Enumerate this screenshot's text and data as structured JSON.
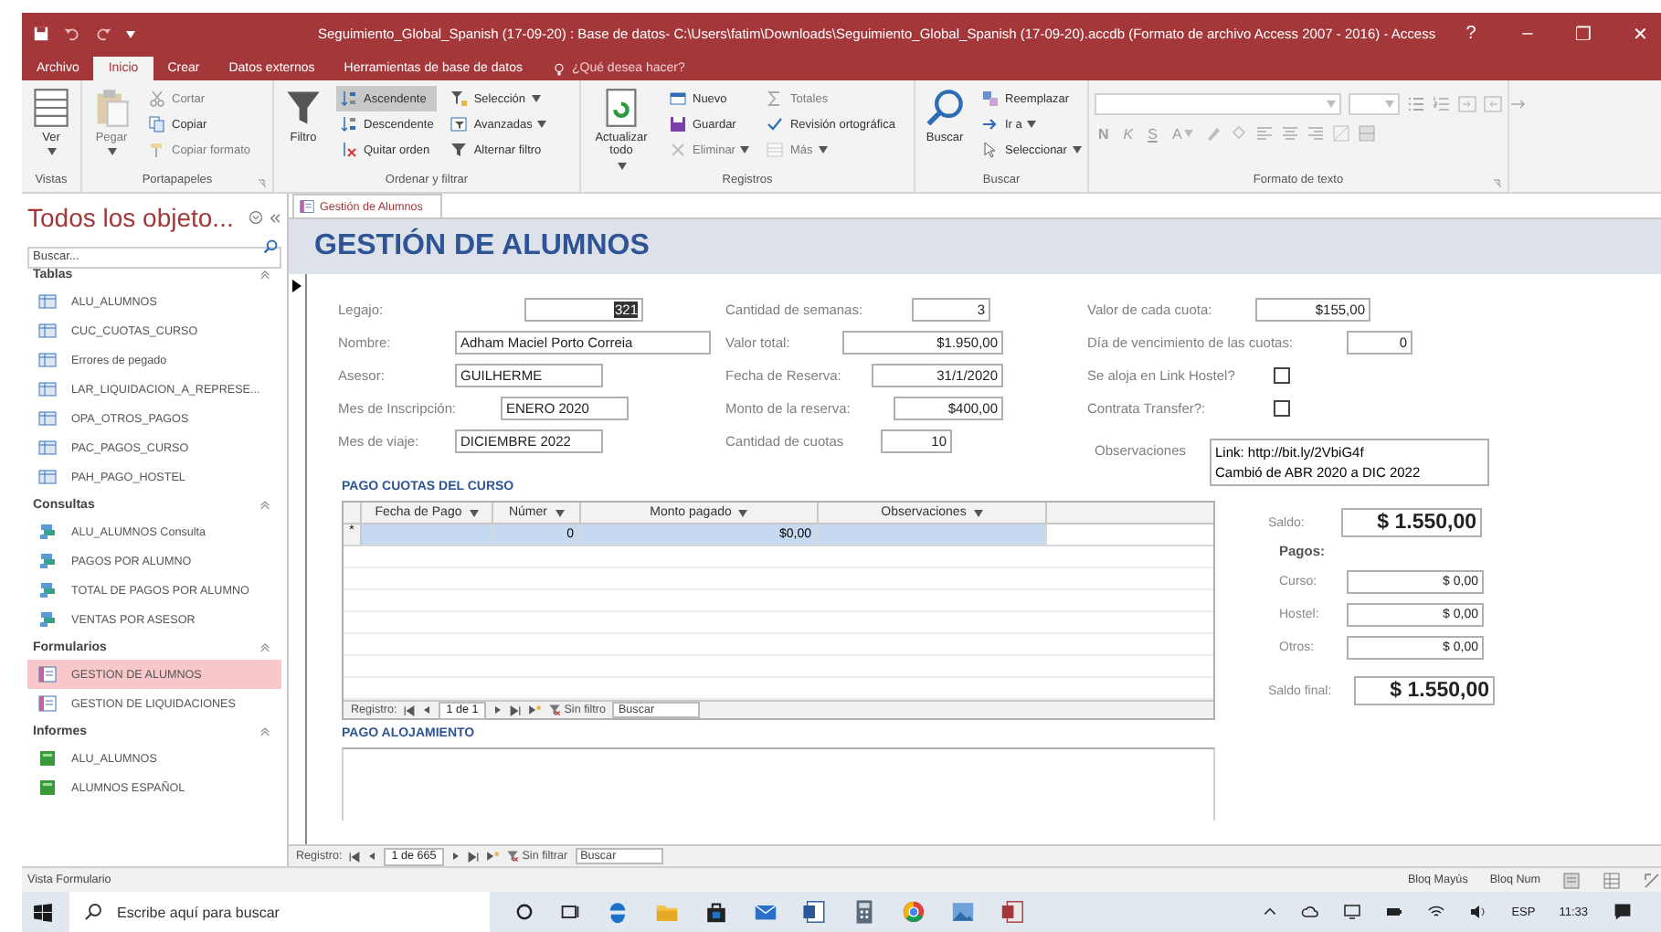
{
  "window": {
    "title": "Seguimiento_Global_Spanish (17-09-20) : Base de datos- C:\\Users\\fatim\\Downloads\\Seguimiento_Global_Spanish (17-09-20).accdb (Formato de archivo Access 2007 - 2016) - Access",
    "controls": [
      "?",
      "–",
      "❐",
      "✕"
    ]
  },
  "ribbon_tabs": [
    {
      "label": "Archivo",
      "selected": false
    },
    {
      "label": "Inicio",
      "selected": true
    },
    {
      "label": "Crear",
      "selected": false
    },
    {
      "label": "Datos externos",
      "selected": false
    },
    {
      "label": "Herramientas de base de datos",
      "selected": false
    }
  ],
  "tell_me": {
    "placeholder": "¿Qué desea hacer?"
  },
  "ribbon_groups": [
    {
      "label": "Vistas",
      "kind": "buttons",
      "large": [
        {
          "label": "Ver",
          "kind": "view",
          "disabled": false,
          "pressed": false,
          "dropdown": true
        }
      ]
    },
    {
      "label": "Portapapeles",
      "kind": "buttons",
      "launcher": true,
      "large": [
        {
          "label": "Pegar",
          "kind": "paste",
          "disabled": true,
          "pressed": false,
          "dropdown": true
        }
      ],
      "columns": [
        [
          {
            "label": "Cortar",
            "kind": "cut",
            "disabled": true,
            "pressed": false,
            "dropdown": false
          },
          {
            "label": "Copiar",
            "kind": "copy",
            "disabled": false,
            "pressed": false,
            "dropdown": false
          },
          {
            "label": "Copiar formato",
            "kind": "brush",
            "disabled": true,
            "pressed": false,
            "dropdown": false
          }
        ]
      ]
    },
    {
      "label": "Ordenar y filtrar",
      "kind": "buttons",
      "large": [
        {
          "label": "Filtro",
          "kind": "filter",
          "disabled": false,
          "pressed": false,
          "dropdown": false
        }
      ],
      "columns": [
        [
          {
            "label": "Ascendente",
            "kind": "sort-asc",
            "disabled": false,
            "pressed": true,
            "dropdown": false
          },
          {
            "label": "Descendente",
            "kind": "sort-desc",
            "disabled": false,
            "pressed": false,
            "dropdown": false
          },
          {
            "label": "Quitar orden",
            "kind": "clear-sort",
            "disabled": false,
            "pressed": false,
            "dropdown": false
          }
        ],
        [
          {
            "label": "Selección",
            "kind": "selection",
            "disabled": false,
            "pressed": false,
            "dropdown": true
          },
          {
            "label": "Avanzadas",
            "kind": "advanced",
            "disabled": false,
            "pressed": false,
            "dropdown": true
          },
          {
            "label": "Alternar filtro",
            "kind": "toggle-filter",
            "disabled": false,
            "pressed": false,
            "dropdown": false
          }
        ]
      ]
    },
    {
      "label": "Registros",
      "kind": "buttons",
      "large": [
        {
          "label": "Actualizar todo",
          "kind": "refresh",
          "disabled": false,
          "pressed": false,
          "dropdown": true
        }
      ],
      "columns": [
        [
          {
            "label": "Nuevo",
            "kind": "new",
            "disabled": false,
            "pressed": false,
            "dropdown": false
          },
          {
            "label": "Guardar",
            "kind": "save",
            "disabled": false,
            "pressed": false,
            "dropdown": false
          },
          {
            "label": "Eliminar",
            "kind": "delete",
            "disabled": true,
            "pressed": false,
            "dropdown": true
          }
        ],
        [
          {
            "label": "Totales",
            "kind": "totals",
            "disabled": true,
            "pressed": false,
            "dropdown": false
          },
          {
            "label": "Revisión ortográfica",
            "kind": "spell",
            "disabled": false,
            "pressed": false,
            "dropdown": false
          },
          {
            "label": "Más",
            "kind": "more",
            "disabled": true,
            "pressed": false,
            "dropdown": true
          }
        ]
      ]
    },
    {
      "label": "Buscar",
      "kind": "buttons",
      "large": [
        {
          "label": "Buscar",
          "kind": "search",
          "disabled": false,
          "pressed": false,
          "dropdown": false
        }
      ],
      "columns": [
        [
          {
            "label": "Reemplazar",
            "kind": "replace",
            "disabled": false,
            "pressed": false,
            "dropdown": false
          },
          {
            "label": "Ir a",
            "kind": "goto",
            "disabled": false,
            "pressed": false,
            "dropdown": true
          },
          {
            "label": "Seleccionar",
            "kind": "select",
            "disabled": false,
            "pressed": false,
            "dropdown": true
          }
        ]
      ]
    },
    {
      "label": "Formato de texto",
      "kind": "format",
      "launcher": true,
      "glyphs": [
        "N",
        "K",
        "S",
        "A"
      ]
    }
  ],
  "nav_pane": {
    "title": "Todos los objeto...",
    "search": {
      "placeholder": "Buscar..."
    },
    "sections": [
      {
        "label": "Tablas",
        "kind": "table",
        "items": [
          {
            "label": "ALU_ALUMNOS",
            "selected": false
          },
          {
            "label": "CUC_CUOTAS_CURSO",
            "selected": false
          },
          {
            "label": "Errores de pegado",
            "selected": false
          },
          {
            "label": "LAR_LIQUIDACION_A_REPRESE...",
            "selected": false
          },
          {
            "label": "OPA_OTROS_PAGOS",
            "selected": false
          },
          {
            "label": "PAC_PAGOS_CURSO",
            "selected": false
          },
          {
            "label": "PAH_PAGO_HOSTEL",
            "selected": false
          }
        ]
      },
      {
        "label": "Consultas",
        "kind": "query",
        "items": [
          {
            "label": "ALU_ALUMNOS Consulta",
            "selected": false
          },
          {
            "label": "PAGOS POR ALUMNO",
            "selected": false
          },
          {
            "label": "TOTAL DE PAGOS POR ALUMNO",
            "selected": false
          },
          {
            "label": "VENTAS POR ASESOR",
            "selected": false
          }
        ]
      },
      {
        "label": "Formularios",
        "kind": "form",
        "items": [
          {
            "label": "GESTION DE ALUMNOS",
            "selected": true
          },
          {
            "label": "GESTION DE LIQUIDACIONES",
            "selected": false
          }
        ]
      },
      {
        "label": "Informes",
        "kind": "report",
        "items": [
          {
            "label": "ALU_ALUMNOS",
            "selected": false
          },
          {
            "label": "ALUMNOS ESPAÑOL",
            "selected": false
          }
        ]
      }
    ]
  },
  "document_tab": {
    "label": "Gestión de Alumnos"
  },
  "form": {
    "title": "GESTIÓN DE ALUMNOS",
    "columns": [
      [
        {
          "label": "Legajo:",
          "kind": "number",
          "value": "321",
          "selected": true
        },
        {
          "label": "Nombre:",
          "kind": "text",
          "value": "Adham Maciel Porto Correia",
          "selected": false
        },
        {
          "label": "Asesor:",
          "kind": "text",
          "value": "GUILHERME",
          "selected": false
        },
        {
          "label": "Mes de Inscripción:",
          "kind": "text",
          "value": "ENERO 2020",
          "selected": false
        },
        {
          "label": "Mes de viaje:",
          "kind": "text",
          "value": "DICIEMBRE 2022",
          "selected": false
        }
      ],
      [
        {
          "label": "Cantidad de semanas:",
          "kind": "number",
          "value": "3",
          "selected": false
        },
        {
          "label": "Valor total:",
          "kind": "number",
          "value": "$1.950,00",
          "selected": false
        },
        {
          "label": "Fecha de Reserva:",
          "kind": "number",
          "value": "31/1/2020",
          "selected": false
        },
        {
          "label": "Monto de la reserva:",
          "kind": "number",
          "value": "$400,00",
          "selected": false
        },
        {
          "label": "Cantidad de cuotas",
          "kind": "number",
          "value": "10",
          "selected": false
        }
      ],
      [
        {
          "label": "Valor de  cada cuota:",
          "kind": "number",
          "value": "$155,00",
          "selected": false
        },
        {
          "label": "Día de vencimiento de las cuotas:",
          "kind": "number",
          "value": "0",
          "selected": false
        },
        {
          "label": "Se aloja en Link Hostel?",
          "kind": "checkbox",
          "checked": false
        },
        {
          "label": "Contrata Transfer?:",
          "kind": "checkbox",
          "checked": false
        },
        {
          "label": "Observaciones",
          "kind": "memo",
          "value": "Link: http://bit.ly/2VbiG4f\nCambió de ABR 2020 a DIC 2022",
          "selected": false
        }
      ]
    ],
    "payments_subform": {
      "title": "PAGO CUOTAS DEL CURSO",
      "columns": [
        "Fecha de Pago",
        "Númer",
        "Monto pagado",
        "Observaciones"
      ],
      "new_row": {
        "marker": "*",
        "cells": [
          null,
          "0",
          "$0,00",
          null
        ]
      },
      "nav": {
        "label": "Registro:",
        "position": "1 de 1",
        "filter": "Sin filtro",
        "search": {
          "placeholder": "Buscar"
        }
      }
    },
    "totals": {
      "balance": {
        "label": "Saldo:",
        "value": "$ 1.550,00"
      },
      "payments_title": "Pagos:",
      "payments": [
        {
          "label": "Curso:",
          "value": "$ 0,00"
        },
        {
          "label": "Hostel:",
          "value": "$ 0,00"
        },
        {
          "label": "Otros:",
          "value": "$ 0,00"
        }
      ],
      "final_balance": {
        "label": "Saldo final:",
        "value": "$ 1.550,00"
      }
    },
    "lodging_section": {
      "title": "PAGO ALOJAMIENTO"
    },
    "record_nav": {
      "label": "Registro:",
      "position": "1 de 665",
      "filter": "Sin filtrar",
      "search": {
        "placeholder": "Buscar"
      }
    }
  },
  "status_bar": {
    "view": "Vista Formulario",
    "indicators": [
      "Bloq Mayús",
      "Bloq Num"
    ]
  },
  "taskbar": {
    "search": {
      "placeholder": "Escribe aquí para buscar"
    },
    "language": "ESP",
    "time": "11:33"
  }
}
